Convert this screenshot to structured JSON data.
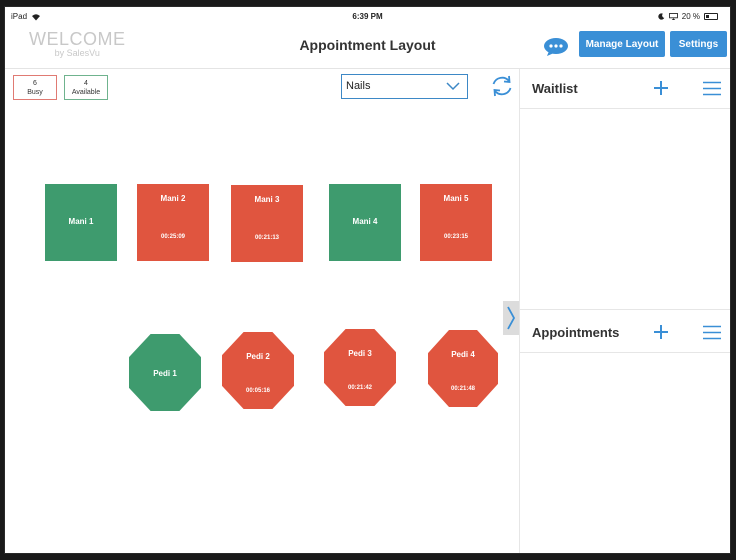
{
  "status_bar": {
    "device": "iPad",
    "time": "6:39 PM",
    "battery": "20 %"
  },
  "header": {
    "logo_main": "WELCOME",
    "logo_sub": "by SalesVu",
    "title": "Appointment Layout",
    "manage_label": "Manage Layout",
    "settings_label": "Settings"
  },
  "counts": {
    "busy_number": "6",
    "busy_label": "Busy",
    "available_number": "4",
    "available_label": "Available"
  },
  "filter": {
    "selected": "Nails"
  },
  "stations": {
    "mani": [
      {
        "name": "Mani 1",
        "time": "",
        "status": "available"
      },
      {
        "name": "Mani 2",
        "time": "00:25:09",
        "status": "busy"
      },
      {
        "name": "Mani 3",
        "time": "00:21:13",
        "status": "busy"
      },
      {
        "name": "Mani 4",
        "time": "",
        "status": "available"
      },
      {
        "name": "Mani 5",
        "time": "00:23:15",
        "status": "busy"
      }
    ],
    "pedi": [
      {
        "name": "Pedi 1",
        "time": "",
        "status": "available"
      },
      {
        "name": "Pedi 2",
        "time": "00:05:16",
        "status": "busy"
      },
      {
        "name": "Pedi 3",
        "time": "00:21:42",
        "status": "busy"
      },
      {
        "name": "Pedi 4",
        "time": "00:21:48",
        "status": "busy"
      }
    ]
  },
  "panels": {
    "waitlist": "Waitlist",
    "appointments": "Appointments"
  },
  "colors": {
    "available": "#3e9b6e",
    "busy": "#e0553f",
    "accent": "#3a8fd6"
  },
  "icons": {
    "chat": "chat-bubble-icon",
    "refresh": "refresh-icon",
    "chevron": "chevron-down-icon",
    "add": "plus-icon",
    "menu": "hamburger-menu-icon",
    "collapse": "chevron-right-icon"
  }
}
